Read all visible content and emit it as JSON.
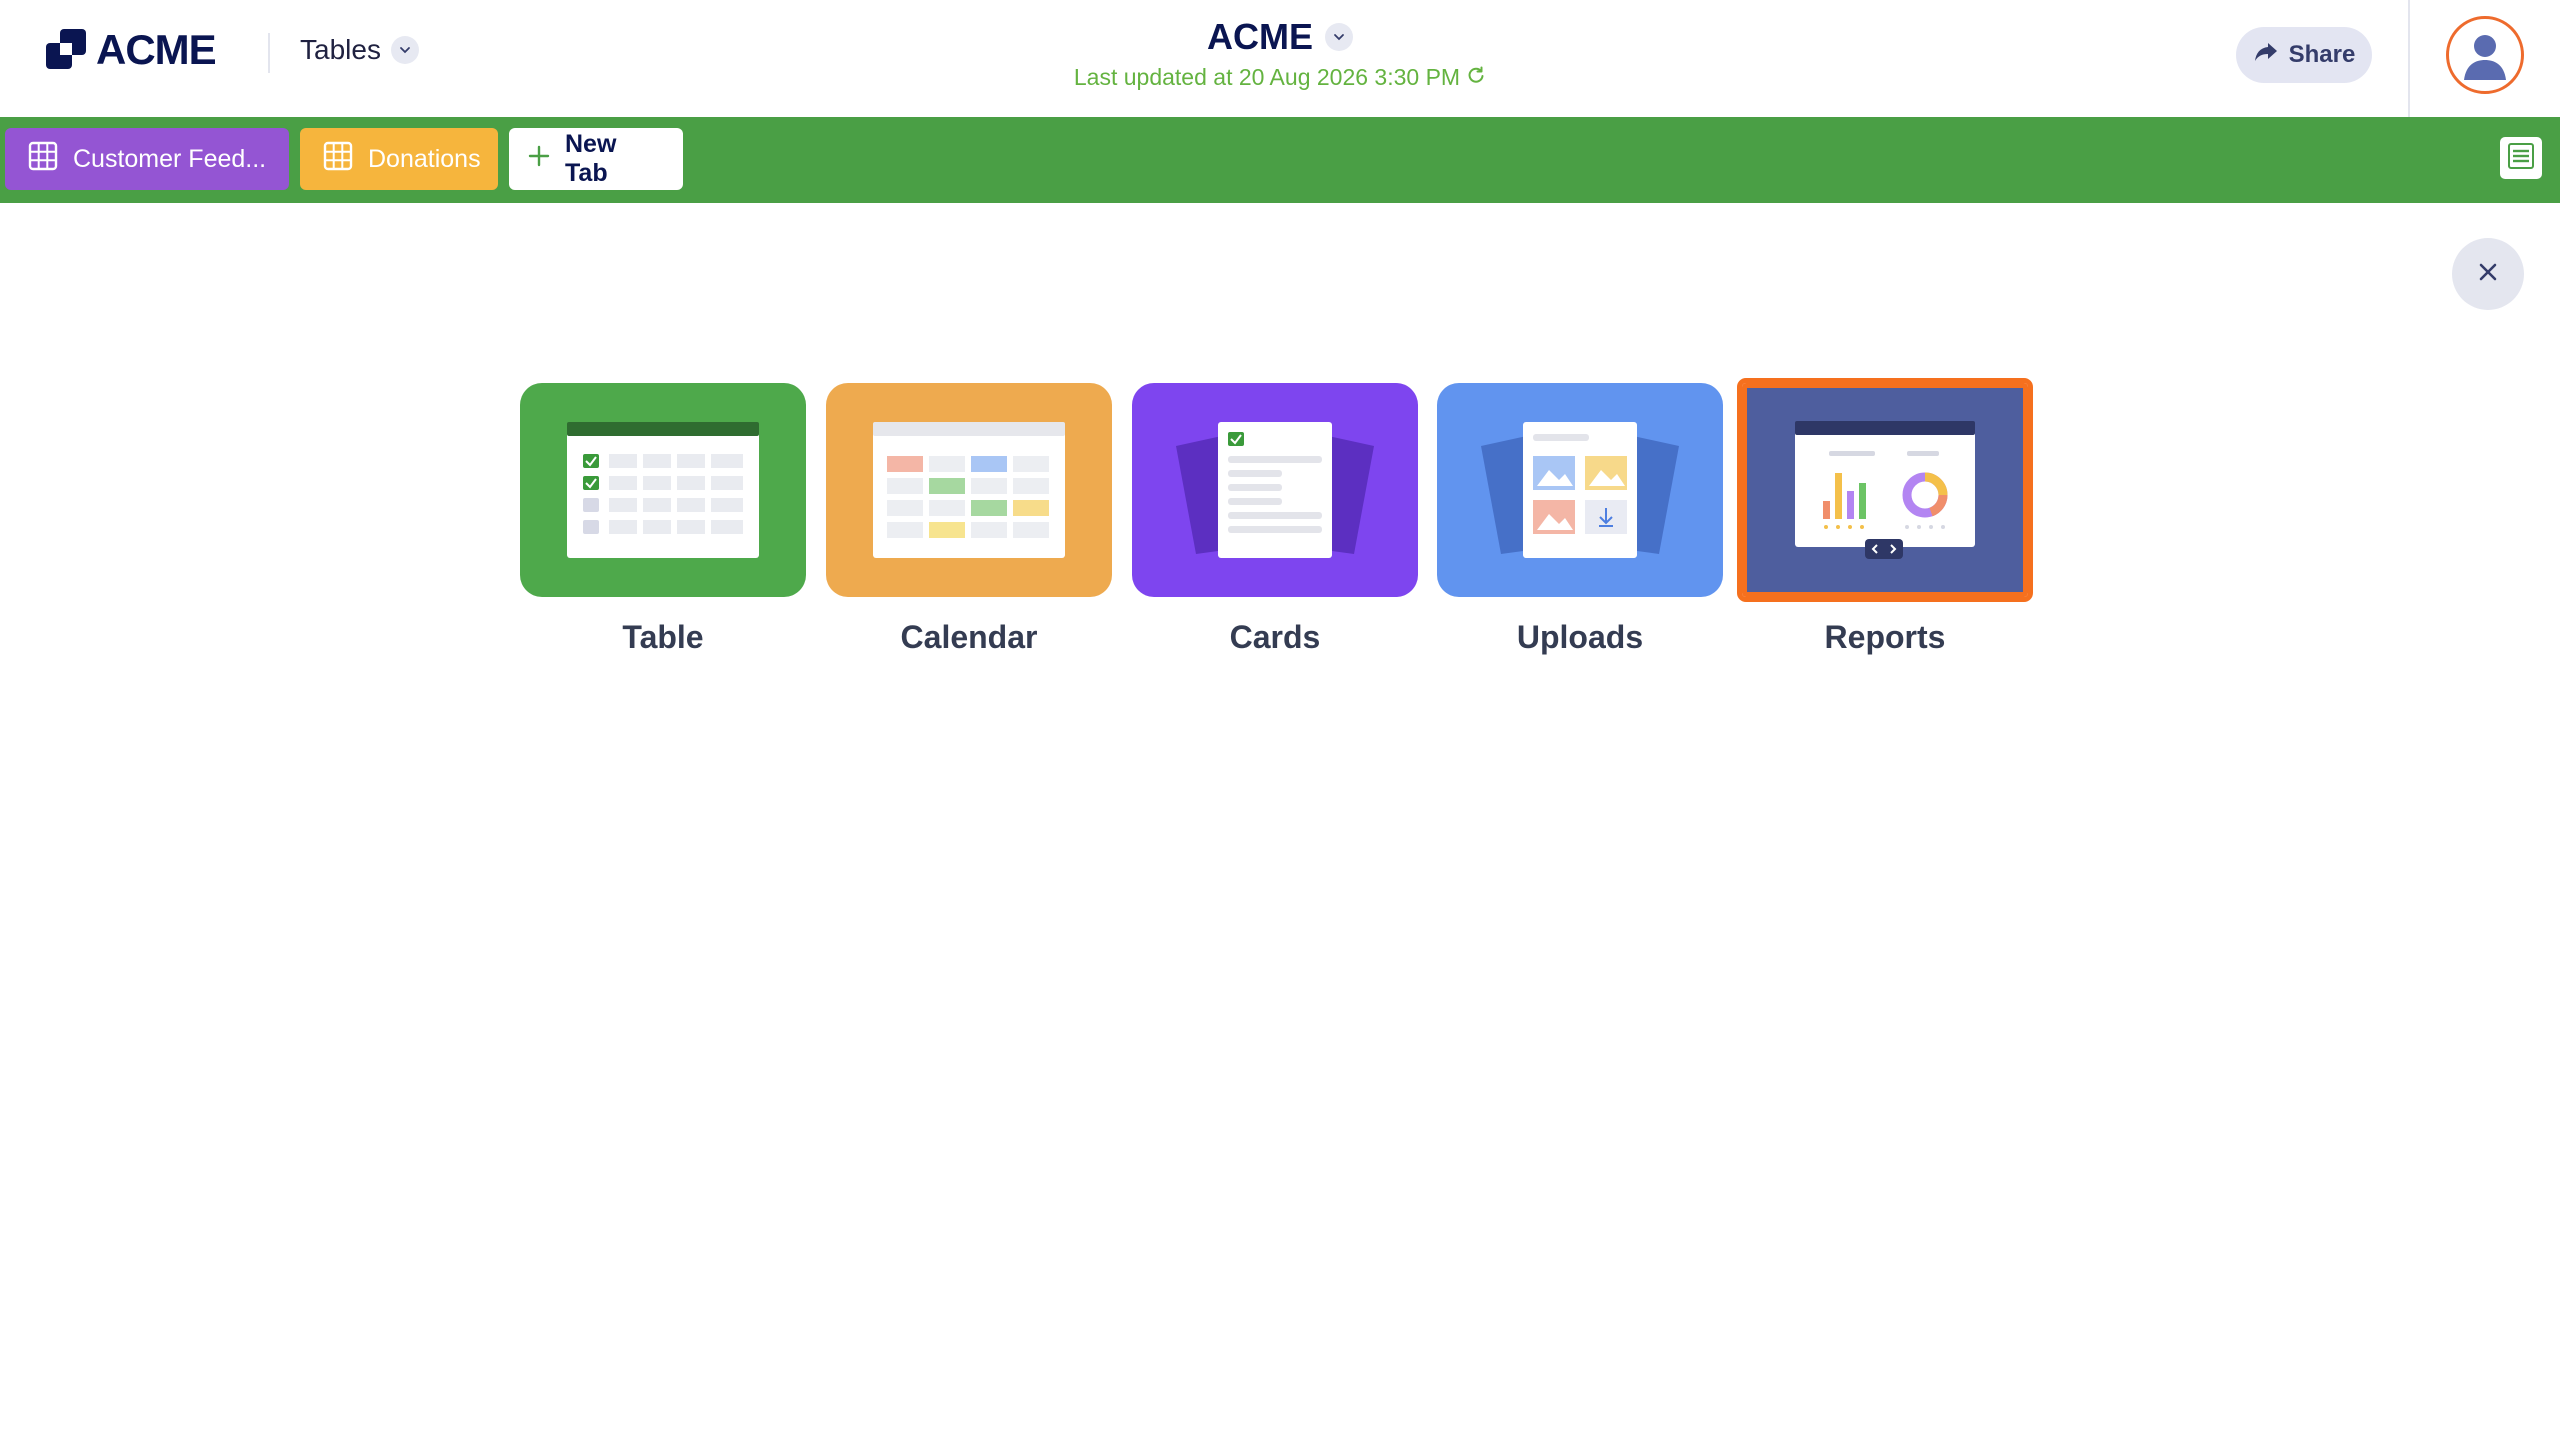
{
  "header": {
    "logo_text": "ACME",
    "product_switcher_label": "Tables",
    "doc_title": "ACME",
    "last_updated": "Last updated at 20 Aug 2026 3:30 PM",
    "share_label": "Share"
  },
  "tabs": [
    {
      "label": "Customer Feed...",
      "color": "#9455d3",
      "icon": "grid-icon"
    },
    {
      "label": "Donations",
      "color": "#f6b53d",
      "icon": "grid-icon"
    }
  ],
  "new_tab_label": "New Tab",
  "view_choices": [
    {
      "label": "Table",
      "color": "#4ea94b"
    },
    {
      "label": "Calendar",
      "color": "#eeaa4f"
    },
    {
      "label": "Cards",
      "color": "#7e45ef"
    },
    {
      "label": "Uploads",
      "color": "#6194ef"
    },
    {
      "label": "Reports",
      "color": "#4e5e9e",
      "selected": true
    }
  ],
  "colors": {
    "brand_navy": "#0a1551",
    "tabbar_green": "#4a9f45",
    "updated_green": "#64b340",
    "selection_orange": "#f5701e"
  }
}
